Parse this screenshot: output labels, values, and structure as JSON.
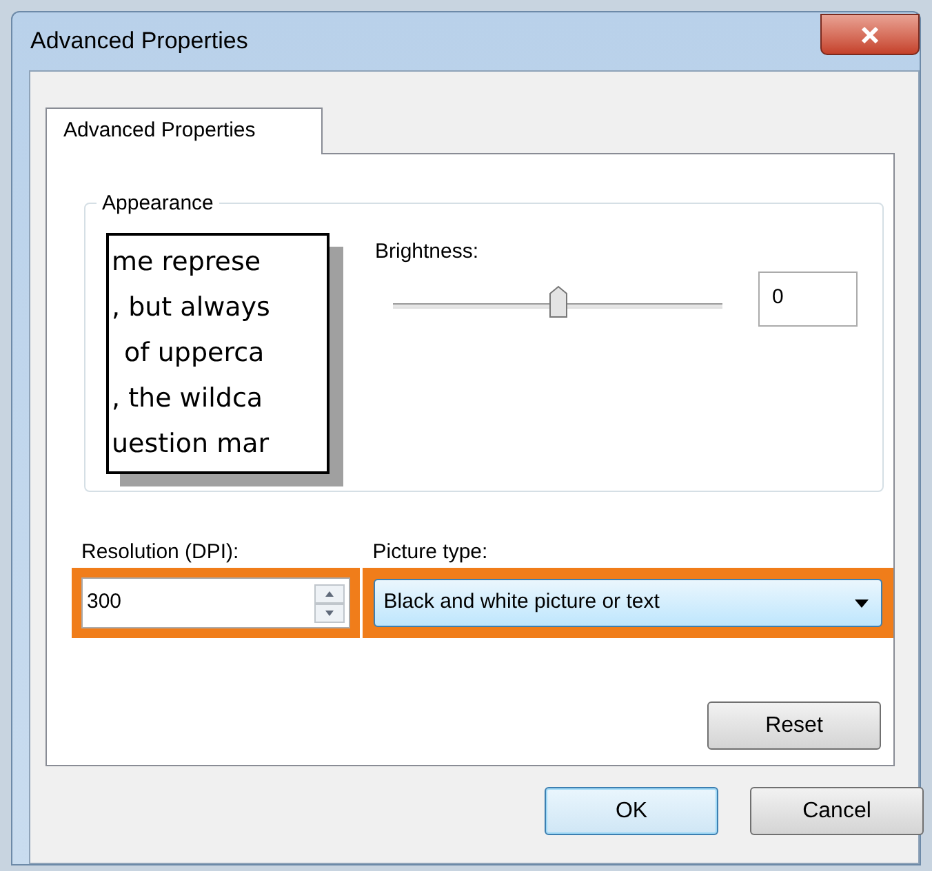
{
  "window": {
    "title": "Advanced Properties"
  },
  "tabs": [
    {
      "label": "Advanced Properties",
      "selected": true
    }
  ],
  "appearance": {
    "title": "Appearance",
    "preview_lines": [
      "me represe",
      ", but always",
      "of upperca",
      ", the wildca",
      "uestion mar"
    ],
    "brightness": {
      "label": "Brightness:",
      "level": 0.5,
      "value": "0"
    }
  },
  "resolution": {
    "label": "Resolution (DPI):",
    "value": "300",
    "highlighted": true
  },
  "picture_type": {
    "label": "Picture type:",
    "value": "Black and white picture or text",
    "highlighted": true
  },
  "reset_button": {
    "label": "Reset"
  },
  "buttons": [
    {
      "label": "OK",
      "default": true
    },
    {
      "label": "Cancel",
      "default": false
    }
  ]
}
